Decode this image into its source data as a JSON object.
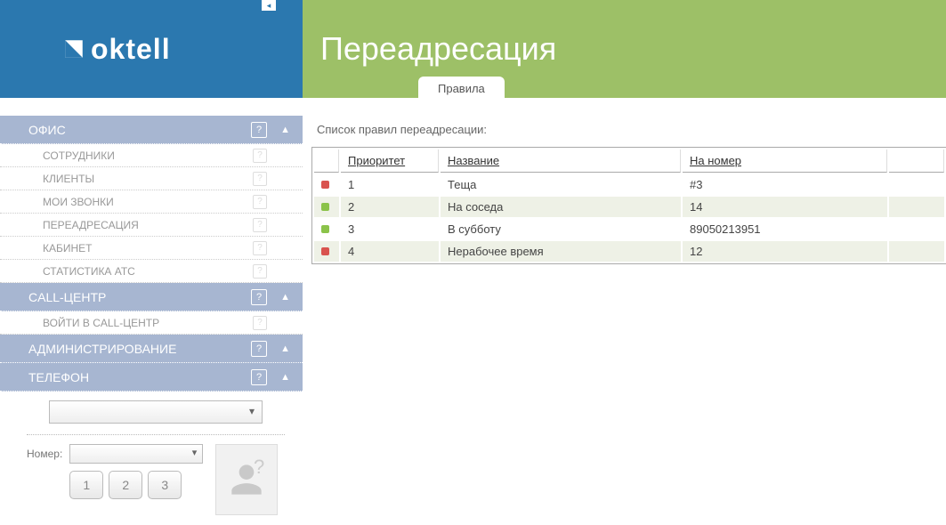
{
  "brand": {
    "name": "oktell"
  },
  "page": {
    "title": "Переадресация"
  },
  "tabs": [
    {
      "label": "Правила"
    }
  ],
  "list_caption": "Список правил переадресации:",
  "sidebar": {
    "groups": [
      {
        "label": "ОФИС",
        "items": [
          {
            "label": "СОТРУДНИКИ"
          },
          {
            "label": "КЛИЕНТЫ"
          },
          {
            "label": "МОИ ЗВОНКИ"
          },
          {
            "label": "ПЕРЕАДРЕСАЦИЯ"
          },
          {
            "label": "КАБИНЕТ"
          },
          {
            "label": "СТАТИСТИКА АТС"
          }
        ]
      },
      {
        "label": "CALL-ЦЕНТР",
        "items": [
          {
            "label": "ВОЙТИ В CALL-ЦЕНТР"
          }
        ]
      },
      {
        "label": "АДМИНИСТРИРОВАНИЕ",
        "items": []
      },
      {
        "label": "ТЕЛЕФОН",
        "items": []
      }
    ]
  },
  "phone_panel": {
    "label": "Номер:",
    "keys": [
      "1",
      "2",
      "3"
    ]
  },
  "columns": {
    "priority": "Приоритет",
    "name": "Название",
    "number": "На номер"
  },
  "rules": [
    {
      "status": "red",
      "priority": "1",
      "name": "Теща",
      "number": "#3"
    },
    {
      "status": "green",
      "priority": "2",
      "name": "На соседа",
      "number": "14"
    },
    {
      "status": "green",
      "priority": "3",
      "name": "В субботу",
      "number": "89050213951"
    },
    {
      "status": "red",
      "priority": "4",
      "name": "Нерабочее время",
      "number": "12"
    }
  ]
}
